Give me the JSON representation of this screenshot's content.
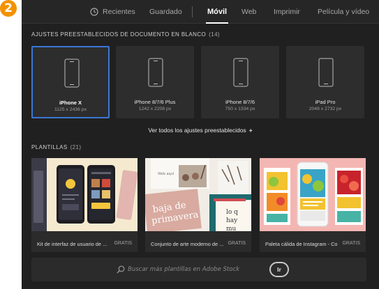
{
  "step_badge": "2",
  "tabs": {
    "recientes": "Recientes",
    "guardado": "Guardado",
    "movil": "Móvil",
    "web": "Web",
    "imprimir": "Imprimir",
    "pelicula": "Película y vídeo",
    "active": "Móvil"
  },
  "presets": {
    "title": "AJUSTES PREESTABLECIDOS DE DOCUMENTO EN BLANCO",
    "count": "(14)",
    "items": [
      {
        "name": "iPhone X",
        "size": "1125 x 2436 px",
        "icon": "phone-icon",
        "selected": true
      },
      {
        "name": "iPhone 8/7/6 Plus",
        "size": "1242 x 2208 px",
        "icon": "phone-icon",
        "selected": false
      },
      {
        "name": "iPhone 8/7/6",
        "size": "750 x 1334 px",
        "icon": "phone-icon",
        "selected": false
      },
      {
        "name": "iPad Pro",
        "size": "2048 x 2732 px",
        "icon": "tablet-icon",
        "selected": false
      }
    ],
    "see_all": "Ver todos los ajustes preestablecidos",
    "see_all_icon": "+"
  },
  "templates": {
    "title": "PLANTILLAS",
    "count": "(21)",
    "items": [
      {
        "label": "Kit de interfaz de usuario de ...",
        "badge": "GRATIS"
      },
      {
        "label": "Conjunto de arte moderno de ...",
        "badge": "GRATIS",
        "thumb_text": [
          "Web aquí",
          "baja de",
          "primavera",
          "lo q",
          "hay",
          "mu"
        ]
      },
      {
        "label": "Paleta cálida de Instagram - Co...",
        "badge": "GRATIS"
      }
    ]
  },
  "search": {
    "placeholder": "Buscar más plantillas en Adobe Stock",
    "value": "",
    "button_label": "Ir"
  },
  "colors": {
    "panel_bg": "#202020",
    "card_bg": "#2d2d2d",
    "selection": "#3a77d6",
    "badge": "#f39200"
  }
}
